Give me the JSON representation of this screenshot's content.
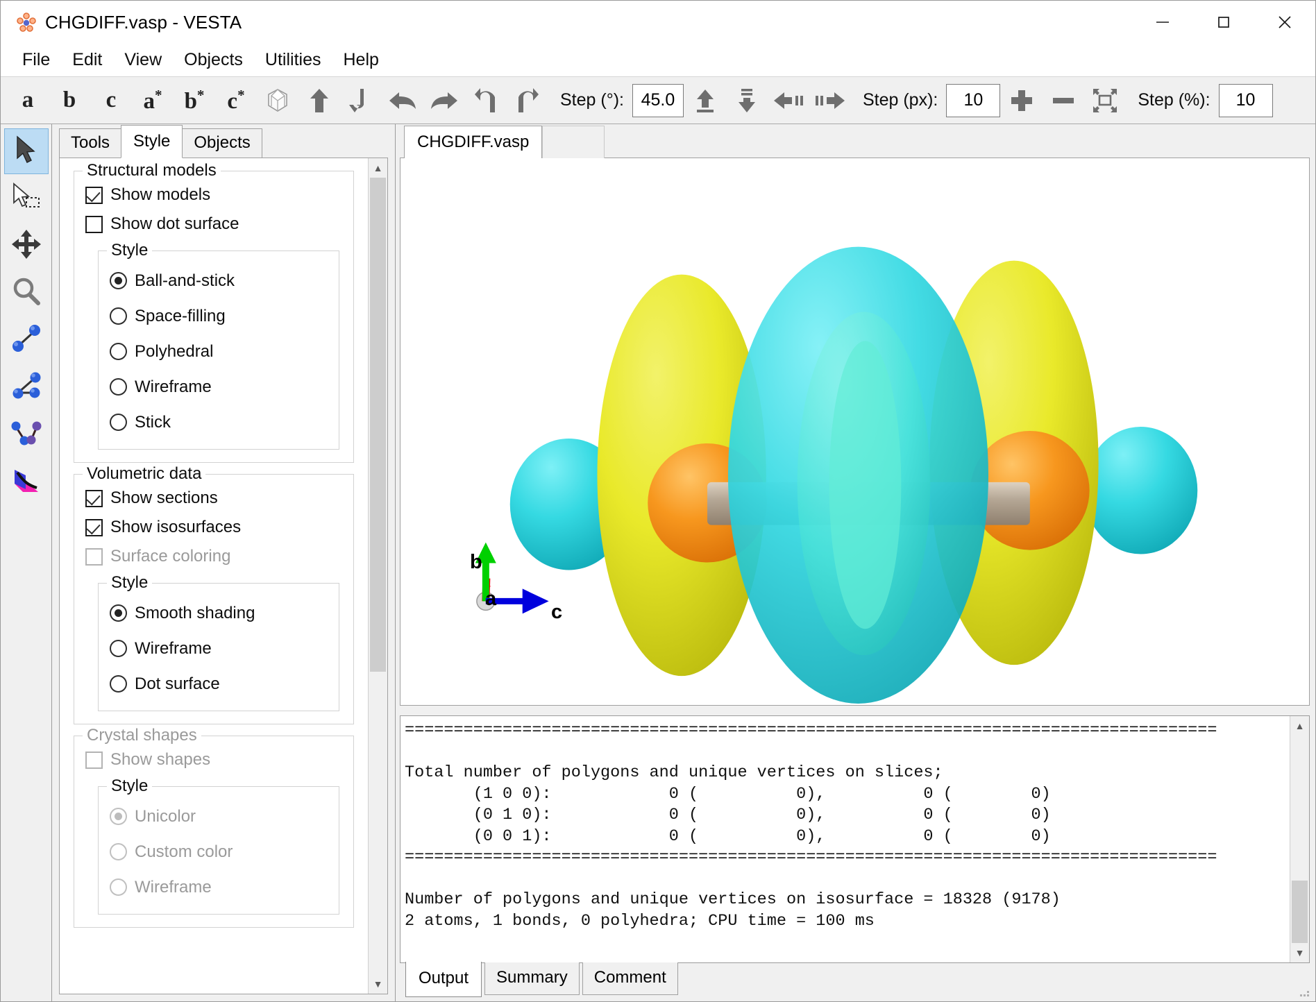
{
  "window": {
    "title": "CHGDIFF.vasp - VESTA",
    "app_icon": "vesta-molecule-icon",
    "controls": [
      {
        "name": "minimize-button",
        "glyph": "—"
      },
      {
        "name": "maximize-button",
        "glyph": "☐"
      },
      {
        "name": "close-button",
        "glyph": "✕"
      }
    ]
  },
  "menubar": {
    "items": [
      {
        "label": "File"
      },
      {
        "label": "Edit"
      },
      {
        "label": "View"
      },
      {
        "label": "Objects"
      },
      {
        "label": "Utilities"
      },
      {
        "label": "Help"
      }
    ]
  },
  "toolbar": {
    "axis_buttons": [
      {
        "name": "view-along-a",
        "label": "a"
      },
      {
        "name": "view-along-b",
        "label": "b"
      },
      {
        "name": "view-along-c",
        "label": "c"
      },
      {
        "name": "view-along-a-star",
        "label": "a*"
      },
      {
        "name": "view-along-b-star",
        "label": "b*"
      },
      {
        "name": "view-along-c-star",
        "label": "c*"
      }
    ],
    "step_deg_label": "Step (°):",
    "step_deg_value": "45.0",
    "step_px_label": "Step (px):",
    "step_px_value": "10",
    "step_pct_label": "Step (%):",
    "step_pct_value": "10"
  },
  "left_tools": [
    {
      "name": "select-tool",
      "icon": "arrow-cursor-icon",
      "active": true
    },
    {
      "name": "box-select-tool",
      "icon": "marquee-select-icon",
      "active": false
    },
    {
      "name": "translate-tool",
      "icon": "move-arrows-icon",
      "active": false
    },
    {
      "name": "zoom-tool",
      "icon": "magnifier-icon",
      "active": false
    },
    {
      "name": "distance-tool",
      "icon": "bond-distance-icon",
      "active": false
    },
    {
      "name": "angle-tool",
      "icon": "bond-angle-icon",
      "active": false
    },
    {
      "name": "torsion-tool",
      "icon": "torsion-angle-icon",
      "active": false
    },
    {
      "name": "plane-tool",
      "icon": "lattice-plane-icon",
      "active": false
    }
  ],
  "side_panel": {
    "tabs": [
      {
        "label": "Tools",
        "active": false
      },
      {
        "label": "Style",
        "active": true
      },
      {
        "label": "Objects",
        "active": false
      }
    ],
    "structural_models": {
      "title": "Structural models",
      "checkboxes": [
        {
          "label": "Show models",
          "checked": true,
          "enabled": true
        },
        {
          "label": "Show dot surface",
          "checked": false,
          "enabled": true
        }
      ],
      "style": {
        "title": "Style",
        "options": [
          {
            "label": "Ball-and-stick",
            "selected": true
          },
          {
            "label": "Space-filling",
            "selected": false
          },
          {
            "label": "Polyhedral",
            "selected": false
          },
          {
            "label": "Wireframe",
            "selected": false
          },
          {
            "label": "Stick",
            "selected": false
          }
        ]
      }
    },
    "volumetric_data": {
      "title": "Volumetric data",
      "checkboxes": [
        {
          "label": "Show sections",
          "checked": true,
          "enabled": true
        },
        {
          "label": "Show isosurfaces",
          "checked": true,
          "enabled": true
        },
        {
          "label": "Surface coloring",
          "checked": false,
          "enabled": false
        }
      ],
      "style": {
        "title": "Style",
        "options": [
          {
            "label": "Smooth shading",
            "selected": true
          },
          {
            "label": "Wireframe",
            "selected": false
          },
          {
            "label": "Dot surface",
            "selected": false
          }
        ]
      }
    },
    "crystal_shapes": {
      "title": "Crystal shapes",
      "checkboxes": [
        {
          "label": "Show shapes",
          "checked": false,
          "enabled": false
        }
      ],
      "style": {
        "title": "Style",
        "options": [
          {
            "label": "Unicolor",
            "selected": true
          },
          {
            "label": "Custom color",
            "selected": false
          },
          {
            "label": "Wireframe",
            "selected": false
          }
        ]
      }
    }
  },
  "viewport": {
    "tab_label": "CHGDIFF.vasp",
    "axes": {
      "b": "b",
      "c": "c",
      "a": "a"
    },
    "colors": {
      "positive_isosurface": "#e5e515",
      "negative_isosurface": "#2fd8e0",
      "atom": "#f2921a",
      "bond": "#9a9a9a",
      "axis_b": "#00d000",
      "axis_c": "#0000dd",
      "axis_a": "#ee0000"
    }
  },
  "console": {
    "text": "===================================================================================\n\nTotal number of polygons and unique vertices on slices;\n       (1 0 0):            0 (          0),          0 (        0)\n       (0 1 0):            0 (          0),          0 (        0)\n       (0 0 1):            0 (          0),          0 (        0)\n===================================================================================\n\nNumber of polygons and unique vertices on isosurface = 18328 (9178)\n2 atoms, 1 bonds, 0 polyhedra; CPU time = 100 ms",
    "tabs": [
      {
        "label": "Output",
        "active": true
      },
      {
        "label": "Summary",
        "active": false
      },
      {
        "label": "Comment",
        "active": false
      }
    ]
  }
}
